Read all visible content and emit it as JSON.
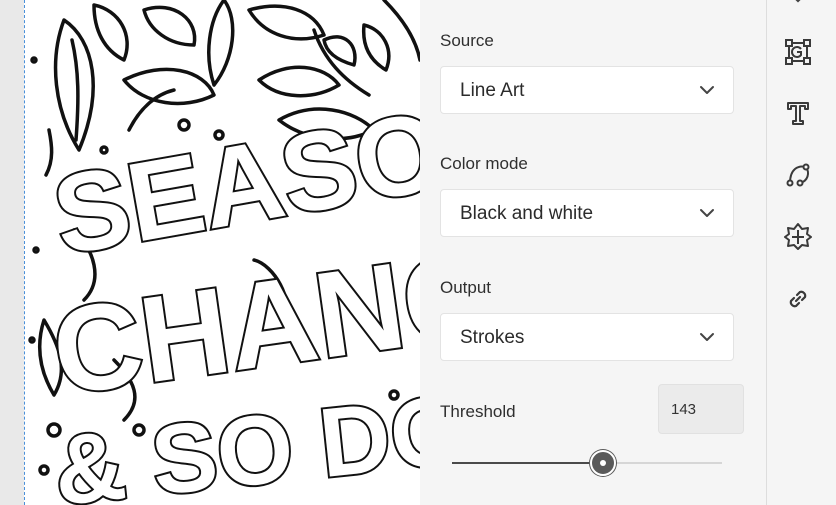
{
  "properties": {
    "source": {
      "label": "Source",
      "value": "Line Art"
    },
    "color_mode": {
      "label": "Color mode",
      "value": "Black and white"
    },
    "output": {
      "label": "Output",
      "value": "Strokes"
    },
    "threshold": {
      "label": "Threshold",
      "value": "143",
      "min": 0,
      "max": 255
    }
  },
  "artwork": {
    "line1": "SEASO",
    "line2": "CHANG",
    "line3": "& SO DO"
  },
  "toolbar": {
    "icons": [
      "image-trace-icon",
      "type-icon",
      "path-curve-icon",
      "effects-icon",
      "link-icon"
    ]
  },
  "colors": {
    "accent_guide": "#4a90d9",
    "panel_bg": "#f5f5f5"
  }
}
